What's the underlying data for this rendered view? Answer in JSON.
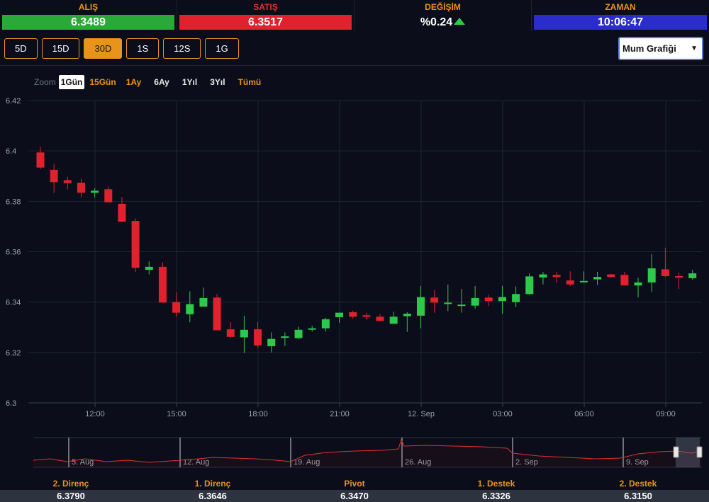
{
  "ticker": {
    "buy": {
      "label": "ALIŞ",
      "value": "6.3489",
      "color": "#2aa838"
    },
    "sell": {
      "label": "SATIŞ",
      "value": "6.3517",
      "color": "#e0212e"
    },
    "change": {
      "label": "DEĞİŞİM",
      "value": "%0.24",
      "direction": "up-triangle-icon"
    },
    "time": {
      "label": "ZAMAN",
      "value": "10:06:47",
      "color": "#2a2ccc"
    }
  },
  "periods": [
    {
      "label": "5D",
      "active": false
    },
    {
      "label": "15D",
      "active": false
    },
    {
      "label": "30D",
      "active": true
    },
    {
      "label": "1S",
      "active": false
    },
    {
      "label": "12S",
      "active": false
    },
    {
      "label": "1G",
      "active": false
    }
  ],
  "chart_type_select": {
    "label": "Mum Grafiği",
    "arrow": "▼"
  },
  "zoom": {
    "label": "Zoom",
    "options": [
      {
        "label": "1Gün",
        "active": true
      },
      {
        "label": "15Gün",
        "active": false
      },
      {
        "label": "1Ay",
        "active": false
      },
      {
        "label": "6Ay",
        "active": false
      },
      {
        "label": "1Yıl",
        "active": false
      },
      {
        "label": "3Yıl",
        "active": false
      },
      {
        "label": "Tümü",
        "active": false
      }
    ]
  },
  "colors": {
    "up": "#2ec84b",
    "down": "#e0212e",
    "grid": "#1f2433",
    "navigator": "#e03030"
  },
  "chart_data": {
    "type": "candlestick",
    "title": "",
    "ylim": [
      6.3,
      6.42
    ],
    "yticks": [
      "6.42",
      "6.4",
      "6.38",
      "6.36",
      "6.34",
      "6.32",
      "6.3"
    ],
    "xticks": [
      "12:00",
      "15:00",
      "18:00",
      "21:00",
      "12. Sep",
      "03:00",
      "06:00",
      "09:00"
    ],
    "candles": [
      {
        "o": 6.3994,
        "h": 6.4016,
        "l": 6.3928,
        "c": 6.3934
      },
      {
        "o": 6.3925,
        "h": 6.3948,
        "l": 6.3834,
        "c": 6.3876
      },
      {
        "o": 6.3884,
        "h": 6.3898,
        "l": 6.3848,
        "c": 6.3872
      },
      {
        "o": 6.3874,
        "h": 6.389,
        "l": 6.3816,
        "c": 6.3834
      },
      {
        "o": 6.3834,
        "h": 6.3852,
        "l": 6.3816,
        "c": 6.3842
      },
      {
        "o": 6.3848,
        "h": 6.3858,
        "l": 6.3796,
        "c": 6.3796
      },
      {
        "o": 6.379,
        "h": 6.3818,
        "l": 6.3719,
        "c": 6.3719
      },
      {
        "o": 6.3722,
        "h": 6.3732,
        "l": 6.352,
        "c": 6.3536
      },
      {
        "o": 6.3528,
        "h": 6.3562,
        "l": 6.351,
        "c": 6.354
      },
      {
        "o": 6.354,
        "h": 6.3558,
        "l": 6.3398,
        "c": 6.3398
      },
      {
        "o": 6.34,
        "h": 6.3438,
        "l": 6.3342,
        "c": 6.3358
      },
      {
        "o": 6.3352,
        "h": 6.3443,
        "l": 6.332,
        "c": 6.3392
      },
      {
        "o": 6.3382,
        "h": 6.3458,
        "l": 6.339,
        "c": 6.3416
      },
      {
        "o": 6.3418,
        "h": 6.3432,
        "l": 6.3288,
        "c": 6.3288
      },
      {
        "o": 6.3292,
        "h": 6.332,
        "l": 6.3258,
        "c": 6.3262
      },
      {
        "o": 6.326,
        "h": 6.3345,
        "l": 6.3198,
        "c": 6.329
      },
      {
        "o": 6.3292,
        "h": 6.332,
        "l": 6.3218,
        "c": 6.3228
      },
      {
        "o": 6.3225,
        "h": 6.328,
        "l": 6.32,
        "c": 6.3254
      },
      {
        "o": 6.3258,
        "h": 6.328,
        "l": 6.3226,
        "c": 6.3264
      },
      {
        "o": 6.3257,
        "h": 6.3302,
        "l": 6.3254,
        "c": 6.329
      },
      {
        "o": 6.3292,
        "h": 6.3306,
        "l": 6.3283,
        "c": 6.3296
      },
      {
        "o": 6.3296,
        "h": 6.3338,
        "l": 6.3284,
        "c": 6.3332
      },
      {
        "o": 6.334,
        "h": 6.3358,
        "l": 6.3318,
        "c": 6.3358
      },
      {
        "o": 6.336,
        "h": 6.3366,
        "l": 6.3334,
        "c": 6.3342
      },
      {
        "o": 6.3348,
        "h": 6.3358,
        "l": 6.333,
        "c": 6.3342
      },
      {
        "o": 6.3342,
        "h": 6.3352,
        "l": 6.3326,
        "c": 6.3326
      },
      {
        "o": 6.3314,
        "h": 6.3362,
        "l": 6.3314,
        "c": 6.3342
      },
      {
        "o": 6.3344,
        "h": 6.336,
        "l": 6.3282,
        "c": 6.3354
      },
      {
        "o": 6.3346,
        "h": 6.3464,
        "l": 6.3296,
        "c": 6.342
      },
      {
        "o": 6.3418,
        "h": 6.3448,
        "l": 6.3358,
        "c": 6.3398
      },
      {
        "o": 6.3398,
        "h": 6.347,
        "l": 6.3364,
        "c": 6.3398
      },
      {
        "o": 6.339,
        "h": 6.3452,
        "l": 6.3358,
        "c": 6.339
      },
      {
        "o": 6.3386,
        "h": 6.3464,
        "l": 6.3374,
        "c": 6.3416
      },
      {
        "o": 6.3418,
        "h": 6.343,
        "l": 6.3384,
        "c": 6.3404
      },
      {
        "o": 6.3404,
        "h": 6.3464,
        "l": 6.3354,
        "c": 6.342
      },
      {
        "o": 6.34,
        "h": 6.3462,
        "l": 6.338,
        "c": 6.3432
      },
      {
        "o": 6.3432,
        "h": 6.3514,
        "l": 6.3429,
        "c": 6.3502
      },
      {
        "o": 6.3498,
        "h": 6.352,
        "l": 6.347,
        "c": 6.351
      },
      {
        "o": 6.3508,
        "h": 6.352,
        "l": 6.3476,
        "c": 6.35
      },
      {
        "o": 6.3486,
        "h": 6.3522,
        "l": 6.3464,
        "c": 6.347
      },
      {
        "o": 6.3484,
        "h": 6.3522,
        "l": 6.3484,
        "c": 6.3484
      },
      {
        "o": 6.349,
        "h": 6.352,
        "l": 6.3468,
        "c": 6.35
      },
      {
        "o": 6.351,
        "h": 6.3512,
        "l": 6.3496,
        "c": 6.35
      },
      {
        "o": 6.3508,
        "h": 6.352,
        "l": 6.349,
        "c": 6.3466
      },
      {
        "o": 6.3466,
        "h": 6.3496,
        "l": 6.3418,
        "c": 6.3478
      },
      {
        "o": 6.3478,
        "h": 6.359,
        "l": 6.344,
        "c": 6.3534
      },
      {
        "o": 6.353,
        "h": 6.3616,
        "l": 6.35,
        "c": 6.3503
      },
      {
        "o": 6.3503,
        "h": 6.3518,
        "l": 6.3452,
        "c": 6.3497
      },
      {
        "o": 6.3495,
        "h": 6.3528,
        "l": 6.349,
        "c": 6.3514
      }
    ],
    "navigator": {
      "labels": [
        "5. Aug",
        "12. Aug",
        "19. Aug",
        "26. Aug",
        "2. Sep",
        "9. Sep"
      ]
    }
  },
  "pivots": [
    {
      "label": "2. Direnç",
      "value": "6.3790"
    },
    {
      "label": "1. Direnç",
      "value": "6.3646"
    },
    {
      "label": "Pivot",
      "value": "6.3470"
    },
    {
      "label": "1. Destek",
      "value": "6.3326"
    },
    {
      "label": "2. Destek",
      "value": "6.3150"
    }
  ]
}
